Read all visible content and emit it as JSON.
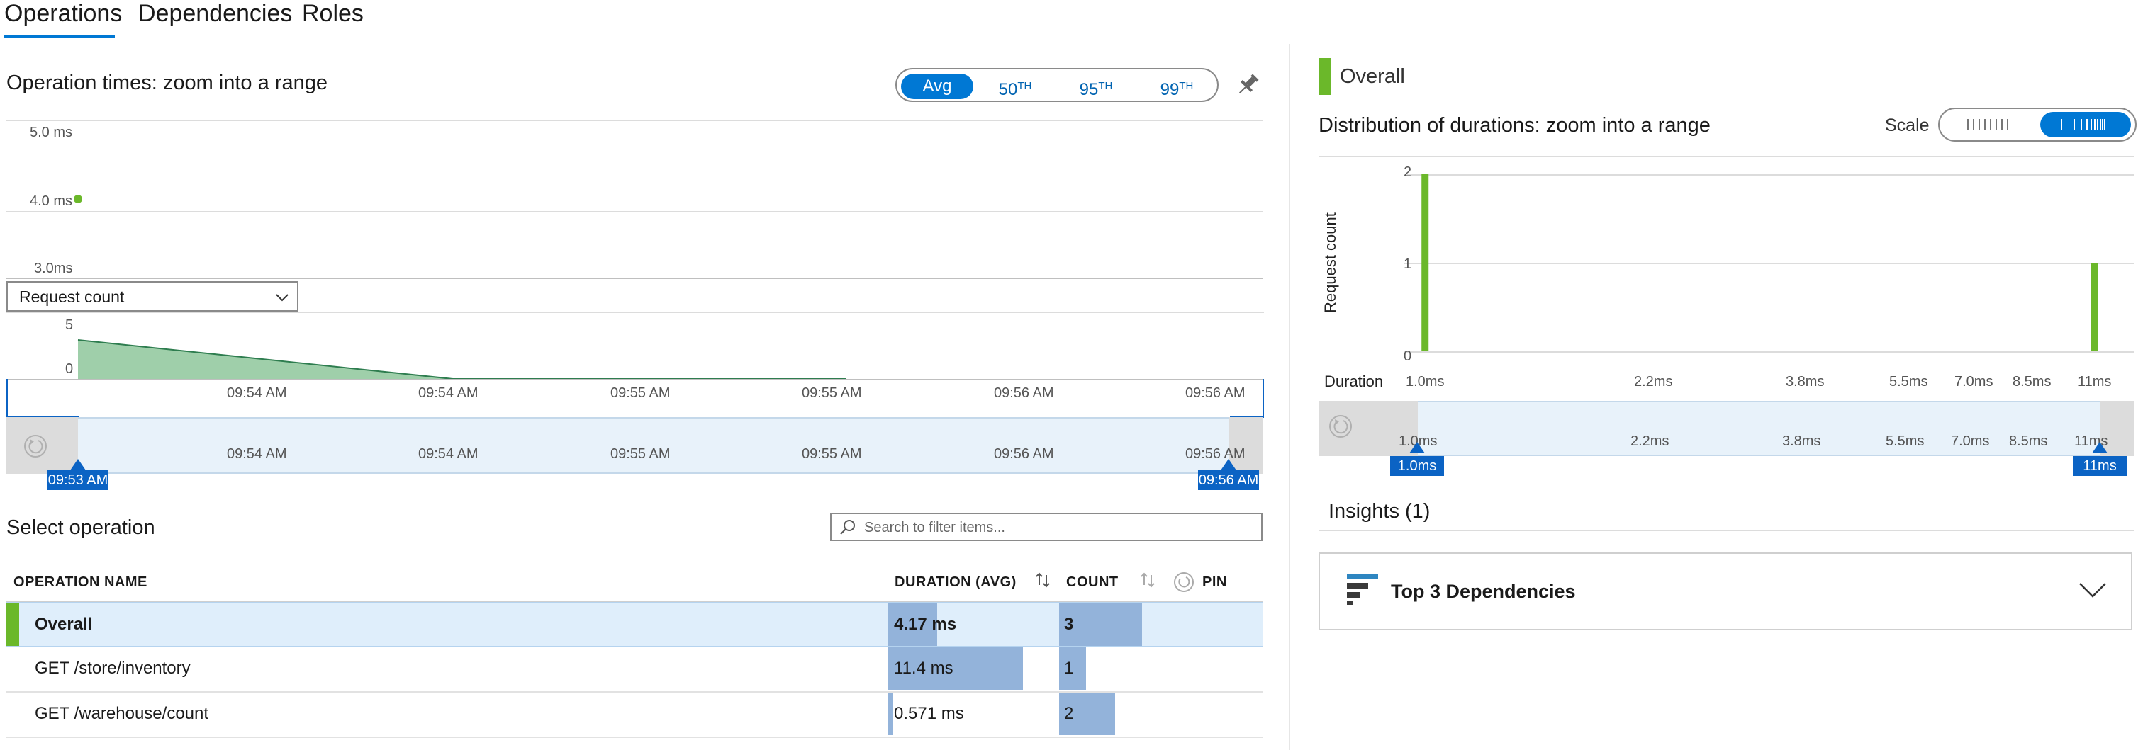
{
  "tabs": [
    {
      "label": "Operations",
      "active": true
    },
    {
      "label": "Dependencies",
      "active": false
    },
    {
      "label": "Roles",
      "active": false
    }
  ],
  "colors": {
    "accent": "#0078d4",
    "success": "#6bb82a",
    "bar": "#93b3da",
    "selected_row": "#dfeefb"
  },
  "left": {
    "title": "Operation times: zoom into a range",
    "percentiles": [
      {
        "label": "Avg",
        "sup": "",
        "selected": true
      },
      {
        "label": "50",
        "sup": "TH",
        "selected": false
      },
      {
        "label": "95",
        "sup": "TH",
        "selected": false
      },
      {
        "label": "99",
        "sup": "TH",
        "selected": false
      }
    ],
    "pin_icon": "pin-icon",
    "duration_chart": {
      "y_ticks": [
        "5.0 ms",
        "4.0 ms",
        "3.0ms"
      ],
      "points": [
        {
          "x": "09:53 AM",
          "y": 4.0,
          "unit": "ms"
        }
      ]
    },
    "metric_select": {
      "value": "Request count"
    },
    "count_chart": {
      "y_ticks": [
        "5",
        "0"
      ],
      "x_ticks": [
        "09:54 AM",
        "09:54 AM",
        "09:55 AM",
        "09:55 AM",
        "09:56 AM",
        "09:56 AM"
      ],
      "series_start_value": 3,
      "series_end_value": 0
    },
    "brush": {
      "x_ticks": [
        "09:54 AM",
        "09:54 AM",
        "09:55 AM",
        "09:55 AM",
        "09:56 AM",
        "09:56 AM"
      ],
      "start_label": "09:53 AM",
      "end_label": "09:56 AM",
      "reset_icon": "reset-zoom-icon"
    },
    "select_operation_title": "Select operation",
    "search_placeholder": "Search to filter items...",
    "table": {
      "headers": {
        "name": "OPERATION NAME",
        "duration": "DURATION (AVG)",
        "count": "COUNT",
        "pin": "PIN"
      },
      "rows": [
        {
          "name": "Overall",
          "duration": "4.17 ms",
          "duration_fraction": 0.365,
          "count": "3",
          "count_fraction": 1.0,
          "selected": true
        },
        {
          "name": "GET /store/inventory",
          "duration": "11.4 ms",
          "duration_fraction": 1.0,
          "count": "1",
          "count_fraction": 0.33,
          "selected": false
        },
        {
          "name": "GET /warehouse/count",
          "duration": "0.571 ms",
          "duration_fraction": 0.05,
          "count": "2",
          "count_fraction": 0.67,
          "selected": false
        }
      ]
    }
  },
  "right": {
    "legend_label": "Overall",
    "title": "Distribution of durations: zoom into a range",
    "scale": {
      "label": "Scale",
      "options": [
        "linear",
        "logarithmic"
      ],
      "selected": "logarithmic"
    },
    "chart_data": {
      "type": "bar",
      "title": "",
      "xlabel": "Duration",
      "ylabel": "Request count",
      "x_ticks": [
        "1.0ms",
        "2.2ms",
        "3.8ms",
        "5.5ms",
        "7.0ms",
        "8.5ms",
        "11ms"
      ],
      "y_ticks": [
        "2",
        "1",
        "0"
      ],
      "ylim": [
        0,
        2
      ],
      "bars": [
        {
          "x": "1.0ms",
          "value": 2
        },
        {
          "x": "11ms",
          "value": 1
        }
      ]
    },
    "brush": {
      "x_ticks": [
        "1.0ms",
        "2.2ms",
        "3.8ms",
        "5.5ms",
        "7.0ms",
        "8.5ms",
        "11ms"
      ],
      "start_label": "1.0ms",
      "end_label": "11ms",
      "reset_icon": "reset-zoom-icon"
    },
    "insights_title": "Insights (1)",
    "insight_card": {
      "title": "Top 3 Dependencies",
      "icon": "dependencies-icon",
      "expand_icon": "chevron-down-icon"
    }
  }
}
